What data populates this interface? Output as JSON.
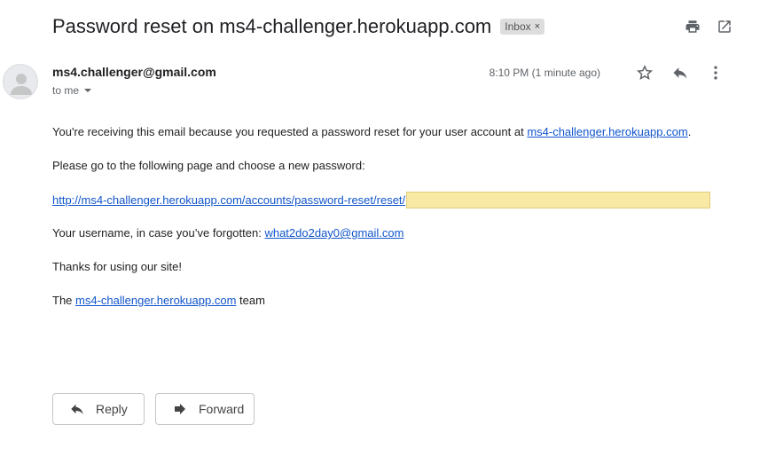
{
  "email": {
    "subject": "Password reset on ms4-challenger.herokuapp.com",
    "label_chip": "Inbox",
    "label_chip_close": "×",
    "sender": "ms4.challenger@gmail.com",
    "recipient_summary": "to me",
    "time": "8:10 PM (1 minute ago)"
  },
  "body": {
    "line1_prefix": "You're receiving this email because you requested a password reset for your user account at ",
    "line1_link": "ms4-challenger.herokuapp.com",
    "line1_suffix": ".",
    "line2": "Please go to the following page and choose a new password:",
    "reset_link": "http://ms4-challenger.herokuapp.com/accounts/password-reset/reset/",
    "username_prefix": "Your username, in case you’ve forgotten: ",
    "username_link": "what2do2day0@gmail.com",
    "thanks": "Thanks for using our site!",
    "signoff_prefix": "The ",
    "signoff_link": "ms4-challenger.herokuapp.com",
    "signoff_suffix": " team"
  },
  "actions": {
    "reply_label": "Reply",
    "forward_label": "Forward"
  }
}
